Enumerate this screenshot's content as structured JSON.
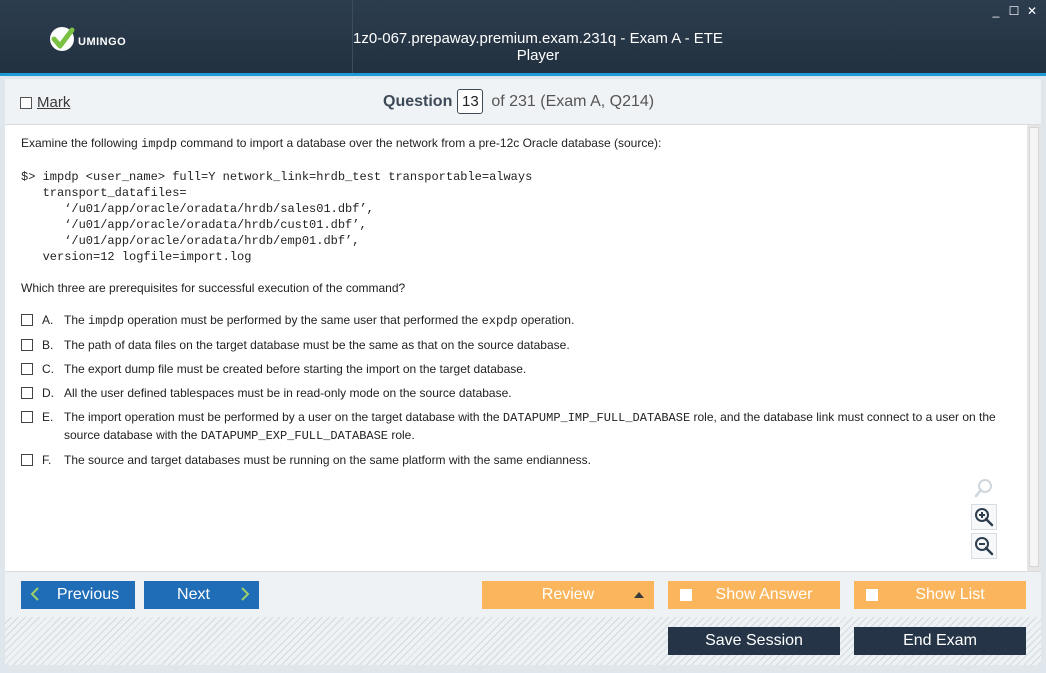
{
  "window": {
    "title": "1z0-067.prepaway.premium.exam.231q - Exam A - ETE Player",
    "logo_text": "UMINGO",
    "controls": [
      "_",
      "☐",
      "✕"
    ]
  },
  "question_bar": {
    "mark_label": "Mark",
    "question_word": "Question",
    "current": "13",
    "of_text": "of 231 (Exam A, Q214)"
  },
  "content": {
    "stem_before": "Examine the following ",
    "stem_cmd": "impdp",
    "stem_after": " command to import a database over the network from a pre-12c Oracle database (source):",
    "code": "$> impdp <user_name> full=Y network_link=hrdb_test transportable=always\n   transport_datafiles=\n      ‘/u01/app/oracle/oradata/hrdb/sales01.dbf’,\n      ‘/u01/app/oracle/oradata/hrdb/cust01.dbf’,\n      ‘/u01/app/oracle/oradata/hrdb/emp01.dbf’,\n   version=12 logfile=import.log",
    "question": "Which three are prerequisites for successful execution of the command?",
    "options": [
      {
        "letter": "A.",
        "p1": "The ",
        "m1": "impdp",
        "p2": " operation must be performed by the same user that performed the ",
        "m2": "expdp",
        "p3": " operation."
      },
      {
        "letter": "B.",
        "p1": "The path of data files on the target database must be the same as that on the source database."
      },
      {
        "letter": "C.",
        "p1": "The export dump file must be created before starting the import on the target database."
      },
      {
        "letter": "D.",
        "p1": "All the user defined tablespaces must be in read-only mode on the source database."
      },
      {
        "letter": "E.",
        "p1": "The import operation must be performed by a user on the target database with the ",
        "m1": "DATAPUMP_IMP_FULL_DATABASE",
        "p2": " role, and the database link must connect to a user on the source database with the ",
        "m2": "DATAPUMP_EXP_FULL_DATABASE",
        "p3": " role."
      },
      {
        "letter": "F.",
        "p1": "The source and target databases must be running on the same platform with the same endianness."
      }
    ]
  },
  "navigation": {
    "previous": "Previous",
    "next": "Next",
    "review": "Review",
    "show_answer": "Show Answer",
    "show_list": "Show List",
    "save_session": "Save Session",
    "end_exam": "End Exam"
  },
  "colors": {
    "title_bg": "#22313f",
    "accent_blue": "#1f6db7",
    "accent_orange": "#fbb65d",
    "dark_button": "#253547",
    "logo_green": "#7ac143"
  },
  "icons": [
    "vumingo-check-logo",
    "search-icon",
    "zoom-in-icon",
    "zoom-out-icon",
    "chevron-left-icon",
    "chevron-right-icon",
    "triangle-up-icon"
  ]
}
